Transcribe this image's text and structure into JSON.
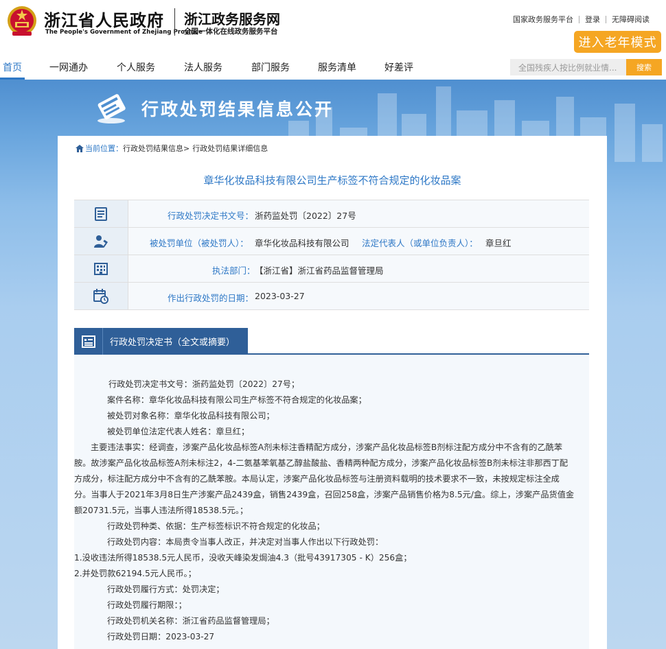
{
  "header": {
    "gov_title": "浙江省人民政府",
    "gov_subtitle": "The People's Government of Zhejiang Province",
    "service_title": "浙江政务服务网",
    "service_subtitle": "全国一体化在线政务服务平台",
    "links": [
      "国家政务服务平台",
      "登录",
      "无障碍阅读"
    ],
    "elder_mode": "进入老年模式"
  },
  "nav": {
    "items": [
      "首页",
      "一网通办",
      "个人服务",
      "法人服务",
      "部门服务",
      "服务清单",
      "好差评"
    ],
    "active": "首页",
    "search_placeholder": "全国残疾人按比例就业情...",
    "search_button": "搜索"
  },
  "banner": {
    "title": "行政处罚结果信息公开"
  },
  "breadcrumb": {
    "label": "当前位置：",
    "items": [
      "行政处罚结果信息>",
      "行政处罚结果详细信息"
    ]
  },
  "case": {
    "title": "章华化妆品科技有限公司生产标签不符合规定的化妆品案",
    "rows": {
      "doc_no_label": "行政处罚决定书文号：",
      "doc_no_value": "浙药监处罚〔2022〕27号",
      "party_label": "被处罚单位（被处罚人）：",
      "party_value": "章华化妆品科技有限公司",
      "rep_label": "法定代表人（或单位负责人）：",
      "rep_value": "章旦红",
      "dept_label": "执法部门：",
      "dept_value": "【浙江省】浙江省药品监督管理局",
      "date_label": "作出行政处罚的日期：",
      "date_value": "2023-03-27"
    }
  },
  "section": {
    "title": "行政处罚决定书（全文或摘要）"
  },
  "document": {
    "lines": [
      "行政处罚决定书文号：浙药监处罚〔2022〕27号；",
      "案件名称：章华化妆品科技有限公司生产标签不符合规定的化妆品案；",
      "被处罚对象名称：章华化妆品科技有限公司；",
      "被处罚单位法定代表人姓名：章旦红；",
      "主要违法事实：经调查，涉案产品化妆品标签A剂未标注香精配方成分，涉案产品化妆品标签B剂标注配方成分中不含有的乙酰苯胺。故涉案产品化妆品标签A剂未标注2，4-二氨基苯氧基乙醇盐酸盐、香精两种配方成分，涉案产品化妆品标签B剂未标注非那西丁配方成分，标注配方成分中不含有的乙酰苯胺。本局认定，涉案产品化妆品标签与注册资料载明的技术要求不一致，未按规定标注全成分。当事人于2021年3月8日生产涉案产品2439盒，销售2439盒，召回258盒，涉案产品销售价格为8.5元/盒。综上，涉案产品货值金额20731.5元，当事人违法所得18538.5元。；",
      "行政处罚种类、依据：生产标签标识不符合规定的化妆品；",
      "行政处罚内容：本局责令当事人改正，并决定对当事人作出以下行政处罚：",
      "1.没收违法所得18538.5元人民币，没收天峰染发焗油4.3（批号43917305 - K）256盒；",
      "2.并处罚款62194.5元人民币。；",
      "行政处罚履行方式：处罚决定；",
      "行政处罚履行期限：；",
      "行政处罚机关名称：浙江省药品监督管理局；",
      "行政处罚日期：2023-03-27"
    ]
  },
  "colors": {
    "primary_blue": "#2e78c6",
    "section_blue": "#2f5f98",
    "orange": "#f5a623"
  }
}
